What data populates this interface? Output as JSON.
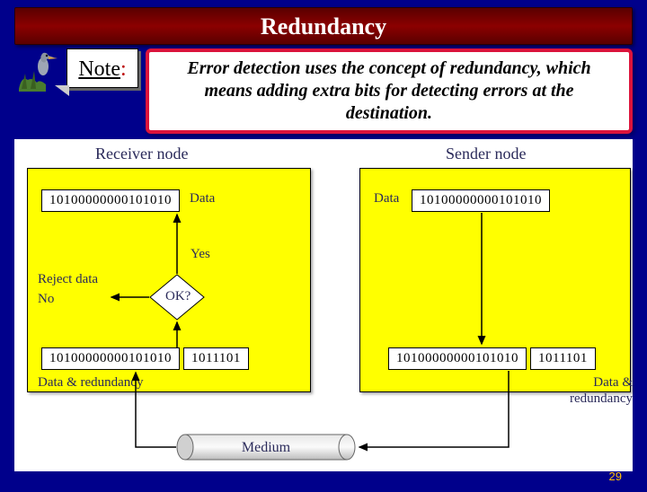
{
  "title": "Redundancy",
  "note_label": "Note",
  "note_colon": ":",
  "note_text": "Error detection uses the concept of redundancy, which means adding extra bits for detecting errors at the destination.",
  "diagram": {
    "receiver_label": "Receiver node",
    "sender_label": "Sender node",
    "rx_data": "10100000000101010",
    "tx_data": "10100000000101010",
    "data_label": "Data",
    "ok_label": "OK?",
    "yes_label": "Yes",
    "no_label": "No",
    "reject_label": "Reject data",
    "rx_combined_data": "10100000000101010",
    "rx_combined_red": "1011101",
    "tx_combined_data": "10100000000101010",
    "tx_combined_red": "1011101",
    "data_red_label": "Data & redundancy",
    "medium_label": "Medium"
  },
  "page_number": "29"
}
